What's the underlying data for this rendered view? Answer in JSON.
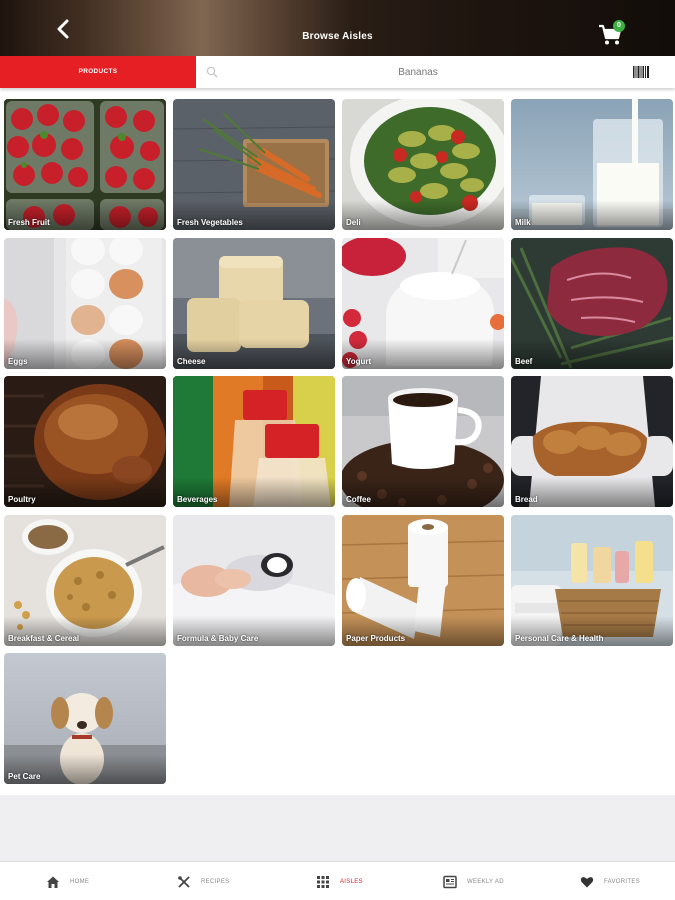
{
  "header": {
    "title": "Browse Aisles",
    "cart_count": "0"
  },
  "search": {
    "tab_label": "PRODUCTS",
    "placeholder": "Bananas"
  },
  "aisles": [
    {
      "label": "Fresh Fruit"
    },
    {
      "label": "Fresh Vegetables"
    },
    {
      "label": "Deli"
    },
    {
      "label": "Milk"
    },
    {
      "label": "Eggs"
    },
    {
      "label": "Cheese"
    },
    {
      "label": "Yogurt"
    },
    {
      "label": "Beef"
    },
    {
      "label": "Poultry"
    },
    {
      "label": "Beverages"
    },
    {
      "label": "Coffee"
    },
    {
      "label": "Bread"
    },
    {
      "label": "Breakfast & Cereal"
    },
    {
      "label": "Formula & Baby Care"
    },
    {
      "label": "Paper Products"
    },
    {
      "label": "Personal Care & Health"
    },
    {
      "label": "Pet Care"
    }
  ],
  "nav": {
    "home": "HOME",
    "recipes": "RECIPES",
    "aisles": "AISLES",
    "weekly_ad": "WEEKLY AD",
    "favorites": "FAVORITES"
  },
  "colors": {
    "accent": "#e51f24",
    "badge": "#3cb043"
  }
}
